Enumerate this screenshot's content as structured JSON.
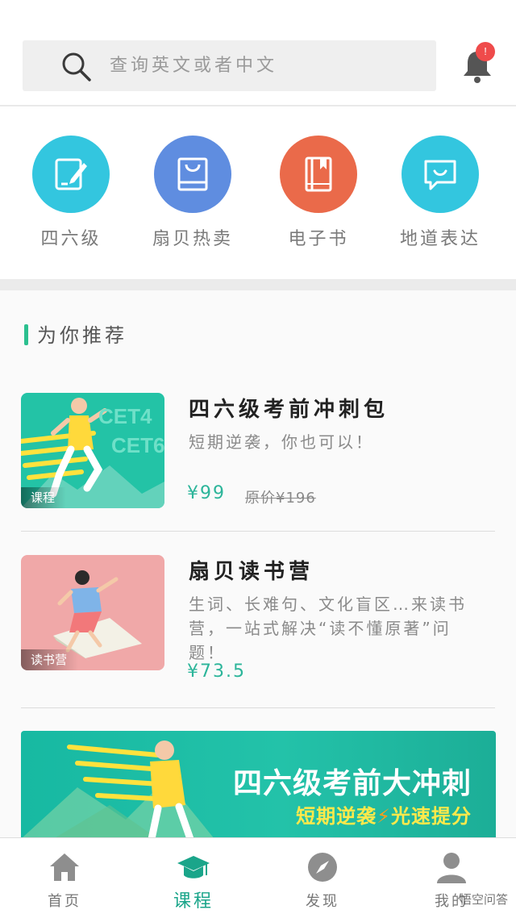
{
  "search": {
    "placeholder": "查询英文或者中文",
    "icon": "search-icon"
  },
  "notifications": {
    "icon": "bell-icon",
    "badge": "!",
    "badge_color": "#ef4b4b"
  },
  "categories": [
    {
      "label": "四六级",
      "icon": "edit-note-icon",
      "color": "#33c6df"
    },
    {
      "label": "扇贝热卖",
      "icon": "shopping-bag-icon",
      "color": "#5f8de0"
    },
    {
      "label": "电子书",
      "icon": "book-icon",
      "color": "#ea6a4a"
    },
    {
      "label": "地道表达",
      "icon": "chat-bubble-icon",
      "color": "#33c6df"
    }
  ],
  "recommended": {
    "title": "为你推荐",
    "accent_color": "#2cc08f",
    "items": [
      {
        "title": "四六级考前冲刺包",
        "description": "短期逆袭，你也可以！",
        "price": "¥99",
        "original_price": "原价¥196",
        "tag": "课程",
        "image_text_1": "CET4",
        "image_text_2": "CET6"
      },
      {
        "title": "扇贝读书营",
        "description": "生词、长难句、文化盲区…来读书营，一站式解决“读不懂原著”问题！",
        "price": "¥73.5",
        "tag": "读书营"
      }
    ]
  },
  "banner": {
    "title": "四六级考前大冲刺",
    "subtitle_part1": "短期逆袭",
    "subtitle_bolt": "⚡",
    "subtitle_part2": "光速提分"
  },
  "bottom_nav": {
    "items": [
      {
        "label": "首页",
        "icon": "home-icon"
      },
      {
        "label": "课程",
        "icon": "graduation-cap-icon",
        "active": true
      },
      {
        "label": "发现",
        "icon": "compass-icon"
      },
      {
        "label": "我的",
        "icon": "user-icon"
      }
    ],
    "active_color": "#1aa58a"
  },
  "watermark": "悟空问答"
}
